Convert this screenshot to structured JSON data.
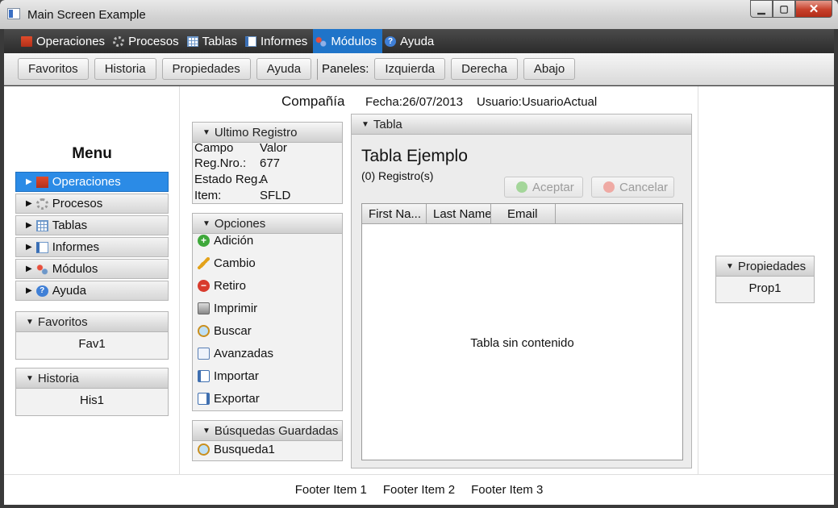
{
  "window": {
    "title": "Main Screen Example"
  },
  "menubar": [
    {
      "label": "Operaciones",
      "icon": "factory-icon"
    },
    {
      "label": "Procesos",
      "icon": "gears-icon"
    },
    {
      "label": "Tablas",
      "icon": "table-icon"
    },
    {
      "label": "Informes",
      "icon": "report-icon"
    },
    {
      "label": "Módulos",
      "icon": "modules-icon",
      "active": true
    },
    {
      "label": "Ayuda",
      "icon": "help-icon"
    }
  ],
  "toolbar": {
    "buttons": [
      "Favoritos",
      "Historia",
      "Propiedades",
      "Ayuda"
    ],
    "panels_label": "Paneles:",
    "panel_buttons": [
      "Izquierda",
      "Derecha",
      "Abajo"
    ]
  },
  "header": {
    "company": "Compañía",
    "date": "Fecha:26/07/2013",
    "user": "Usuario:UsuarioActual"
  },
  "left": {
    "menu_title": "Menu",
    "nav": [
      {
        "label": "Operaciones",
        "selected": true
      },
      {
        "label": "Procesos"
      },
      {
        "label": "Tablas"
      },
      {
        "label": "Informes"
      },
      {
        "label": "Módulos"
      },
      {
        "label": "Ayuda"
      }
    ],
    "favoritos": {
      "title": "Favoritos",
      "items": [
        "Fav1"
      ]
    },
    "historia": {
      "title": "Historia",
      "items": [
        "His1"
      ]
    }
  },
  "ultimo_registro": {
    "title": "Ultimo Registro",
    "rows": [
      {
        "k": "Campo",
        "v": "Valor"
      },
      {
        "k": "Reg.Nro.:",
        "v": "677"
      },
      {
        "k": "Estado Reg.:",
        "v": "A"
      },
      {
        "k": "Item:",
        "v": "SFLD"
      }
    ]
  },
  "opciones": {
    "title": "Opciones",
    "items": [
      "Adición",
      "Cambio",
      "Retiro",
      "Imprimir",
      "Buscar",
      "Avanzadas",
      "Importar",
      "Exportar"
    ]
  },
  "busquedas": {
    "title": "Búsquedas Guardadas",
    "items": [
      "Busqueda1"
    ]
  },
  "tabla": {
    "pane_title": "Tabla",
    "title": "Tabla Ejemplo",
    "count": "(0) Registro(s)",
    "accept": "Aceptar",
    "cancel": "Cancelar",
    "columns": [
      "First Na...",
      "Last Name",
      "Email"
    ],
    "empty": "Tabla sin contenido"
  },
  "propiedades": {
    "title": "Propiedades",
    "items": [
      "Prop1"
    ]
  },
  "footer": [
    "Footer Item 1",
    "Footer Item 2",
    "Footer Item 3"
  ],
  "colors": {
    "accent": "#1f74c9",
    "selected": "#2b8be6"
  }
}
